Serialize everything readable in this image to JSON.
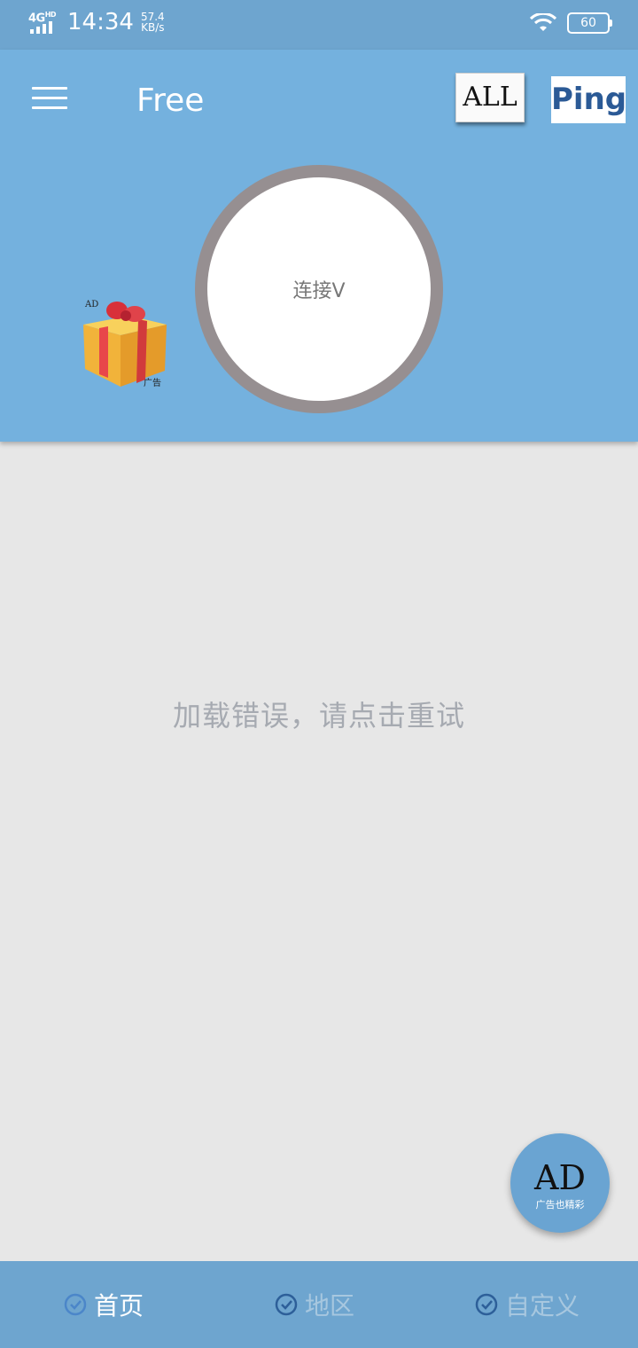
{
  "status_bar": {
    "network": "4G",
    "network_sup": "HD",
    "time": "14:34",
    "speed_value": "57.4",
    "speed_unit": "KB/s",
    "battery": "60"
  },
  "app_bar": {
    "title": "Free",
    "all_button": "ALL",
    "ping_button": "Ping"
  },
  "connect": {
    "label": "连接V"
  },
  "gift_ad": {
    "top_label": "AD",
    "bottom_label": "广告"
  },
  "main": {
    "error_message": "加载错误，请点击重试"
  },
  "fab_ad": {
    "big": "AD",
    "small": "广告也精彩"
  },
  "bottom_nav": {
    "items": [
      {
        "label": "首页",
        "active": true
      },
      {
        "label": "地区",
        "active": false
      },
      {
        "label": "自定义",
        "active": false
      }
    ]
  },
  "colors": {
    "app_bar": "#74b1de",
    "status_bar": "#6ea5cf",
    "ring": "#968f91",
    "background": "#e7e7e7"
  }
}
